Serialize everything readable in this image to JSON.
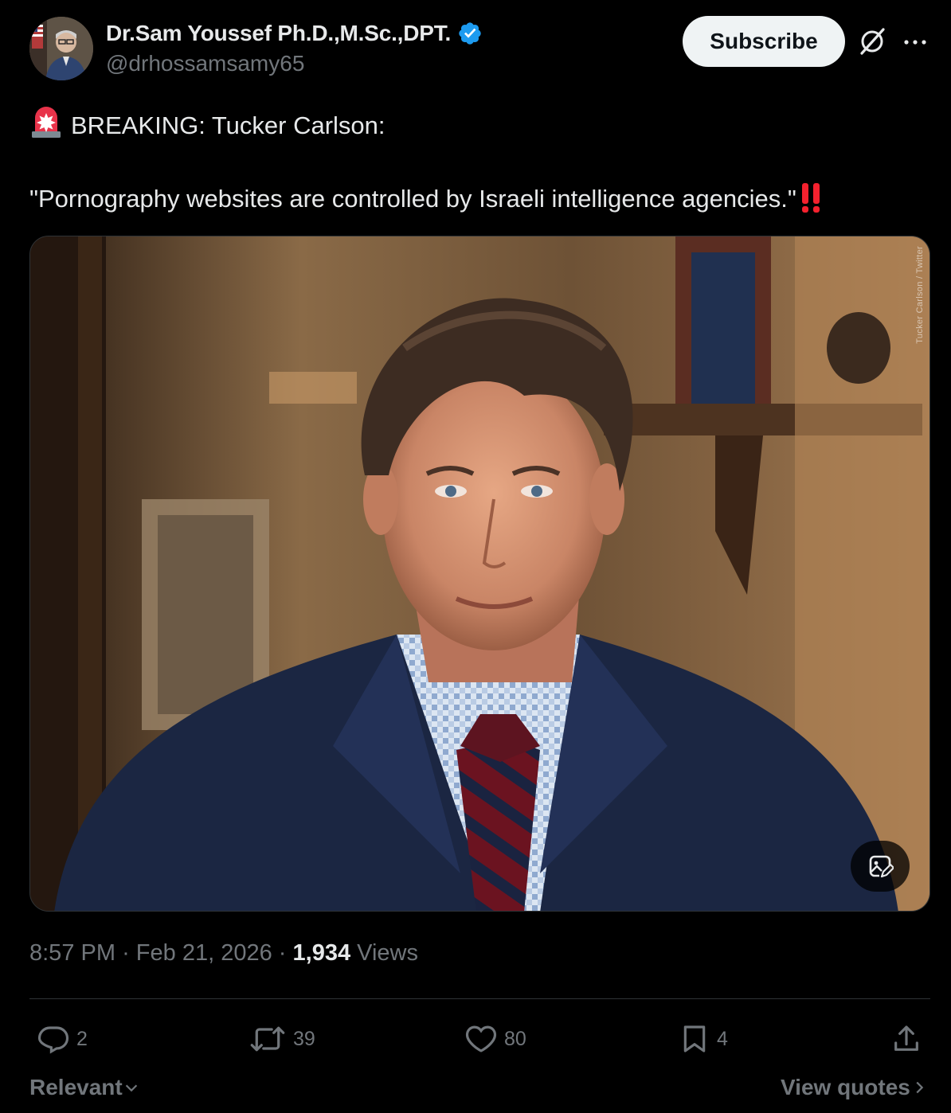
{
  "author": {
    "display_name": "Dr.Sam Youssef Ph.D.,M.Sc.,DPT.",
    "handle": "@drhossamsamy65",
    "verified": true,
    "verified_color": "#1d9bf0"
  },
  "header": {
    "subscribe_label": "Subscribe",
    "icons": [
      "grok-icon",
      "more-icon"
    ]
  },
  "tweet": {
    "line1": "BREAKING: Tucker Carlson:",
    "line2": "\"Pornography websites are controlled by Israeli intelligence agencies.\"",
    "emoji_lead": "police-siren-icon",
    "emoji_trail": "double-exclamation-icon"
  },
  "media": {
    "watermark": "Tucker Carlson / Twitter",
    "badge_icon": "image-edit-icon"
  },
  "meta": {
    "time": "8:57 PM",
    "separator": "·",
    "date": "Feb 21, 2026",
    "views_count": "1,934",
    "views_label": "Views"
  },
  "actions": {
    "replies": "2",
    "reposts": "39",
    "likes": "80",
    "bookmarks": "4"
  },
  "footer": {
    "sort_label": "Relevant",
    "view_quotes_label": "View quotes"
  },
  "colors": {
    "background": "#000000",
    "text_primary": "#e7e9ea",
    "text_secondary": "#71767b",
    "divider": "#2f3336",
    "accent_blue": "#1d9bf0",
    "alert_red": "#f4212e"
  }
}
